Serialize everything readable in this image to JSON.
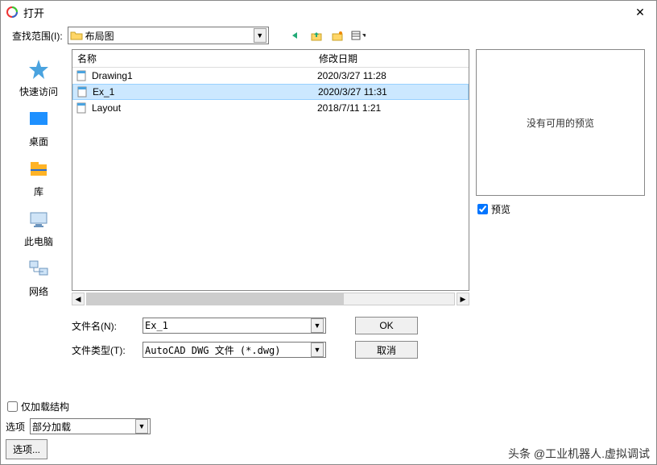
{
  "window": {
    "title": "打开",
    "close": "✕"
  },
  "lookin": {
    "label": "查找范围(I):",
    "value": "布局图"
  },
  "sidebar": {
    "items": [
      {
        "label": "快速访问"
      },
      {
        "label": "桌面"
      },
      {
        "label": "库"
      },
      {
        "label": "此电脑"
      },
      {
        "label": "网络"
      }
    ]
  },
  "filelist": {
    "columns": {
      "name": "名称",
      "date": "修改日期"
    },
    "rows": [
      {
        "name": "Drawing1",
        "date": "2020/3/27 11:28",
        "selected": false
      },
      {
        "name": "Ex_1",
        "date": "2020/3/27 11:31",
        "selected": true
      },
      {
        "name": "Layout",
        "date": "2018/7/11 1:21",
        "selected": false
      }
    ]
  },
  "form": {
    "filename_label": "文件名(N):",
    "filename_value": "Ex_1",
    "filetype_label": "文件类型(T):",
    "filetype_value": "AutoCAD DWG 文件 (*.dwg)",
    "ok": "OK",
    "cancel": "取消"
  },
  "preview": {
    "nopreview": "没有可用的预览",
    "checkbox_label": "预览"
  },
  "bottom": {
    "load_struct_label": "仅加载结构",
    "options_label": "选项",
    "options_value": "部分加载",
    "options_btn": "选项..."
  },
  "footer": "头条 @工业机器人.虚拟调试"
}
